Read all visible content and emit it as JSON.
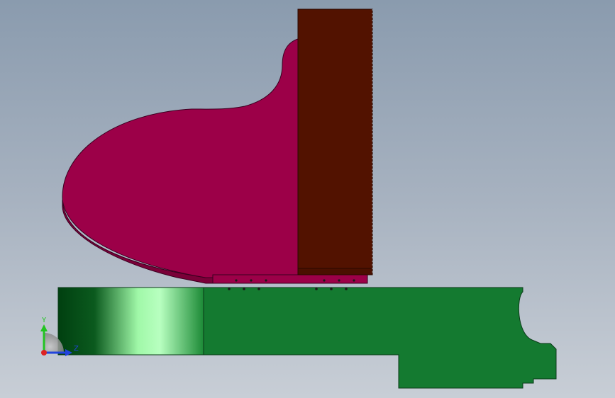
{
  "viewport": {
    "label": "cad-model-viewport",
    "colors": {
      "background_top": "#8a9bae",
      "background_bottom": "#c8ced6",
      "lid_body": "#9c0048",
      "lid_edge": "#7a0038",
      "lid_outline": "#3a0020",
      "vertical_block": "#521200",
      "vertical_block_edge": "#3a0c00",
      "base_plate": "#147a30",
      "base_plate_outline": "#0a3a18",
      "cylinder_dark": "#004010",
      "cylinder_light": "#b0ffb8",
      "holes": "#1a1a1a"
    }
  },
  "triad": {
    "y_label": "Y",
    "z_label": "Z",
    "y_color": "#22c422",
    "z_color": "#2244dd",
    "origin_color": "#dd2222"
  }
}
